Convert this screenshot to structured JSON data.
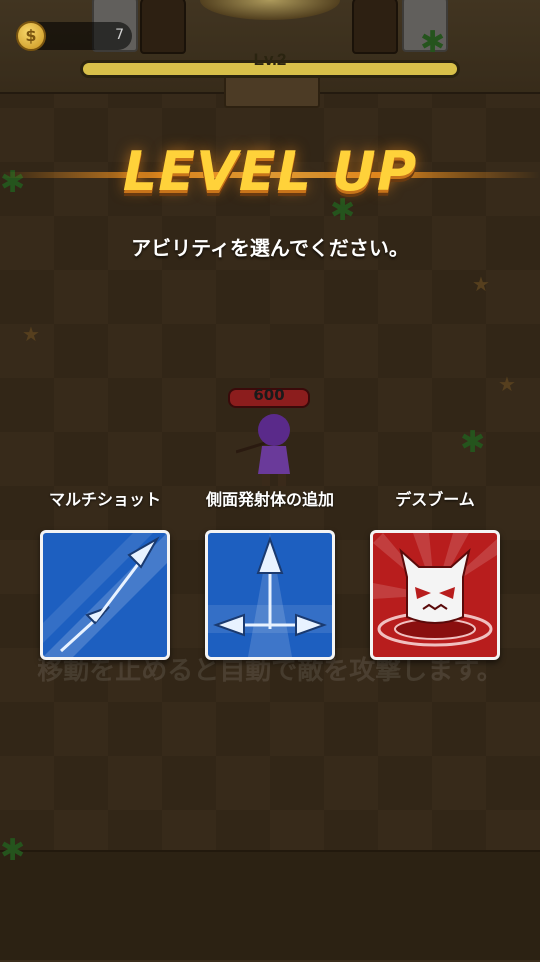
{
  "hud": {
    "coin_count": "7",
    "level_label": "Lv.2",
    "level_progress": 1.0
  },
  "overlay": {
    "title": "LEVEL UP",
    "subtitle": "アビリティを選んでください。"
  },
  "player": {
    "hp": "600"
  },
  "background_hint": "移動を止めると自動で敵を攻撃します。",
  "abilities": [
    {
      "name": "マルチショット",
      "icon": "multishot-arrows-icon",
      "color": "#1d5fc0"
    },
    {
      "name": "側面発射体の追加",
      "icon": "side-arrows-icon",
      "color": "#1d5fc0"
    },
    {
      "name": "デスブーム",
      "icon": "death-boom-devil-icon",
      "color": "#b81d1d"
    }
  ]
}
